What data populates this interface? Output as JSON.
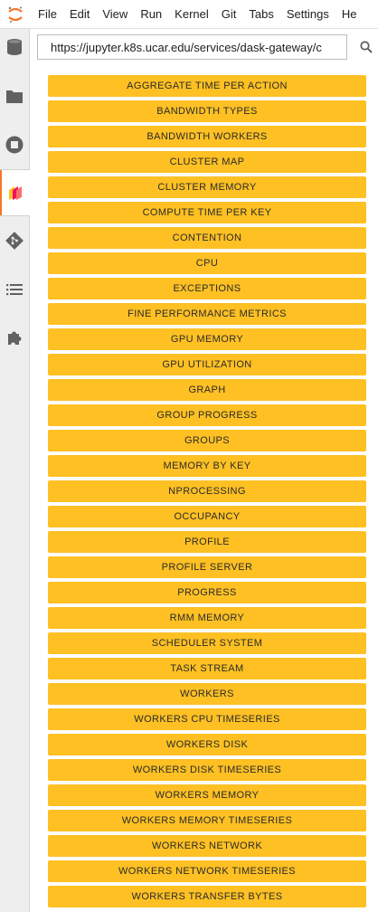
{
  "menu": [
    "File",
    "Edit",
    "View",
    "Run",
    "Kernel",
    "Git",
    "Tabs",
    "Settings",
    "He"
  ],
  "url_input": {
    "value": "https://jupyter.k8s.ucar.edu/services/dask-gateway/c"
  },
  "sidebar_icons": [
    "running-icon",
    "folder-icon",
    "stop-icon",
    "dask-icon",
    "git-icon",
    "toc-icon",
    "extension-icon"
  ],
  "colors": {
    "button": "#fec023",
    "accent": "#f37726"
  },
  "buttons": [
    "AGGREGATE TIME PER ACTION",
    "BANDWIDTH TYPES",
    "BANDWIDTH WORKERS",
    "CLUSTER MAP",
    "CLUSTER MEMORY",
    "COMPUTE TIME PER KEY",
    "CONTENTION",
    "CPU",
    "EXCEPTIONS",
    "FINE PERFORMANCE METRICS",
    "GPU MEMORY",
    "GPU UTILIZATION",
    "GRAPH",
    "GROUP PROGRESS",
    "GROUPS",
    "MEMORY BY KEY",
    "NPROCESSING",
    "OCCUPANCY",
    "PROFILE",
    "PROFILE SERVER",
    "PROGRESS",
    "RMM MEMORY",
    "SCHEDULER SYSTEM",
    "TASK STREAM",
    "WORKERS",
    "WORKERS CPU TIMESERIES",
    "WORKERS DISK",
    "WORKERS DISK TIMESERIES",
    "WORKERS MEMORY",
    "WORKERS MEMORY TIMESERIES",
    "WORKERS NETWORK",
    "WORKERS NETWORK TIMESERIES",
    "WORKERS TRANSFER BYTES"
  ]
}
